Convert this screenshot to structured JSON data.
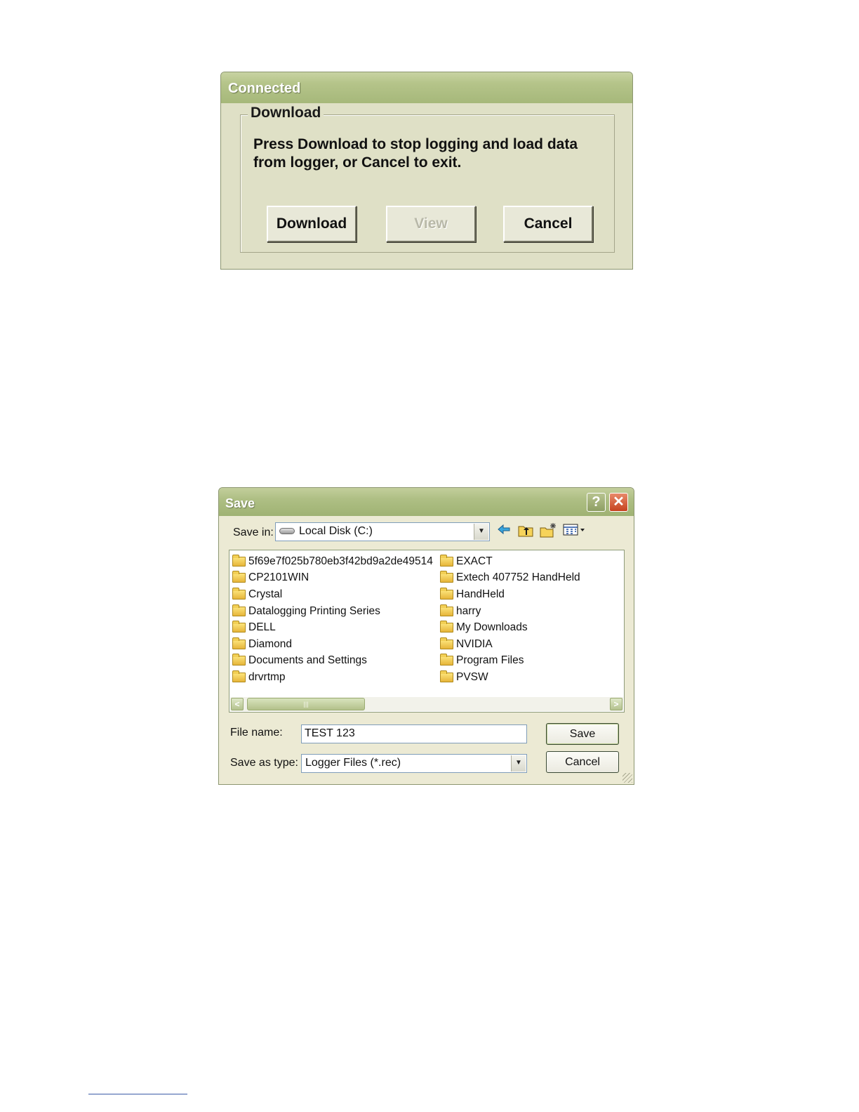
{
  "connected_dialog": {
    "title": "Connected",
    "group_label": "Download",
    "message": "Press Download to stop logging and load data from logger, or Cancel to exit.",
    "buttons": {
      "download": "Download",
      "view": "View",
      "cancel": "Cancel"
    }
  },
  "save_dialog": {
    "title": "Save",
    "title_buttons": {
      "help": "?",
      "close": "✕"
    },
    "save_in_label": "Save in:",
    "save_in_value": "Local Disk (C:)",
    "toolbar_icons": [
      "back-icon",
      "up-folder-icon",
      "new-folder-icon",
      "view-menu-icon"
    ],
    "folders_col1": [
      "5f69e7f025b780eb3f42bd9a2de49514",
      "CP2101WIN",
      "Crystal",
      "Datalogging Printing Series",
      "DELL",
      "Diamond",
      "Documents and Settings",
      "drvrtmp"
    ],
    "folders_col2": [
      "EXACT",
      "Extech 407752 HandHeld",
      "HandHeld",
      "harry",
      "My Downloads",
      "NVIDIA",
      "Program Files",
      "PVSW"
    ],
    "file_name_label": "File name:",
    "file_name_value": "TEST 123",
    "save_type_label": "Save as type:",
    "save_type_value": "Logger Files (*.rec)",
    "buttons": {
      "save": "Save",
      "cancel": "Cancel"
    }
  },
  "colors": {
    "title_bar": "#aebf84",
    "dialog_face": "#ecead4",
    "close_button": "#c6421e"
  }
}
